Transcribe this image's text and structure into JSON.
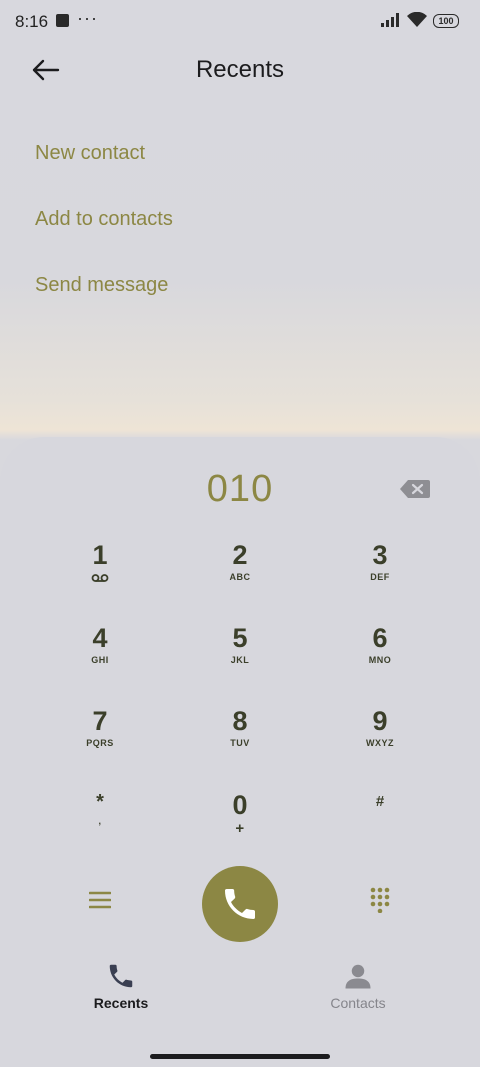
{
  "status_bar": {
    "time": "8:16",
    "more": "···",
    "battery": "100"
  },
  "header": {
    "title": "Recents"
  },
  "menu": [
    {
      "label": "New contact"
    },
    {
      "label": "Add to contacts"
    },
    {
      "label": "Send message"
    }
  ],
  "dialer": {
    "number": "010",
    "keys": [
      {
        "digit": "1",
        "letters": ""
      },
      {
        "digit": "2",
        "letters": "ABC"
      },
      {
        "digit": "3",
        "letters": "DEF"
      },
      {
        "digit": "4",
        "letters": "GHI"
      },
      {
        "digit": "5",
        "letters": "JKL"
      },
      {
        "digit": "6",
        "letters": "MNO"
      },
      {
        "digit": "7",
        "letters": "PQRS"
      },
      {
        "digit": "8",
        "letters": "TUV"
      },
      {
        "digit": "9",
        "letters": "WXYZ"
      },
      {
        "digit": "*",
        "letters": ","
      },
      {
        "digit": "0",
        "letters": "+"
      },
      {
        "digit": "#",
        "letters": ""
      }
    ]
  },
  "bottom_nav": [
    {
      "label": "Recents",
      "icon": "phone-icon",
      "active": true
    },
    {
      "label": "Contacts",
      "icon": "person-icon",
      "active": false
    }
  ],
  "colors": {
    "accent": "#8c8744",
    "background": "#d7d7dd",
    "key_text": "#3b3f2a"
  },
  "icons": [
    "back-arrow-icon",
    "backspace-icon",
    "voicemail-icon",
    "menu-icon",
    "dialpad-icon",
    "phone-icon",
    "person-icon"
  ]
}
